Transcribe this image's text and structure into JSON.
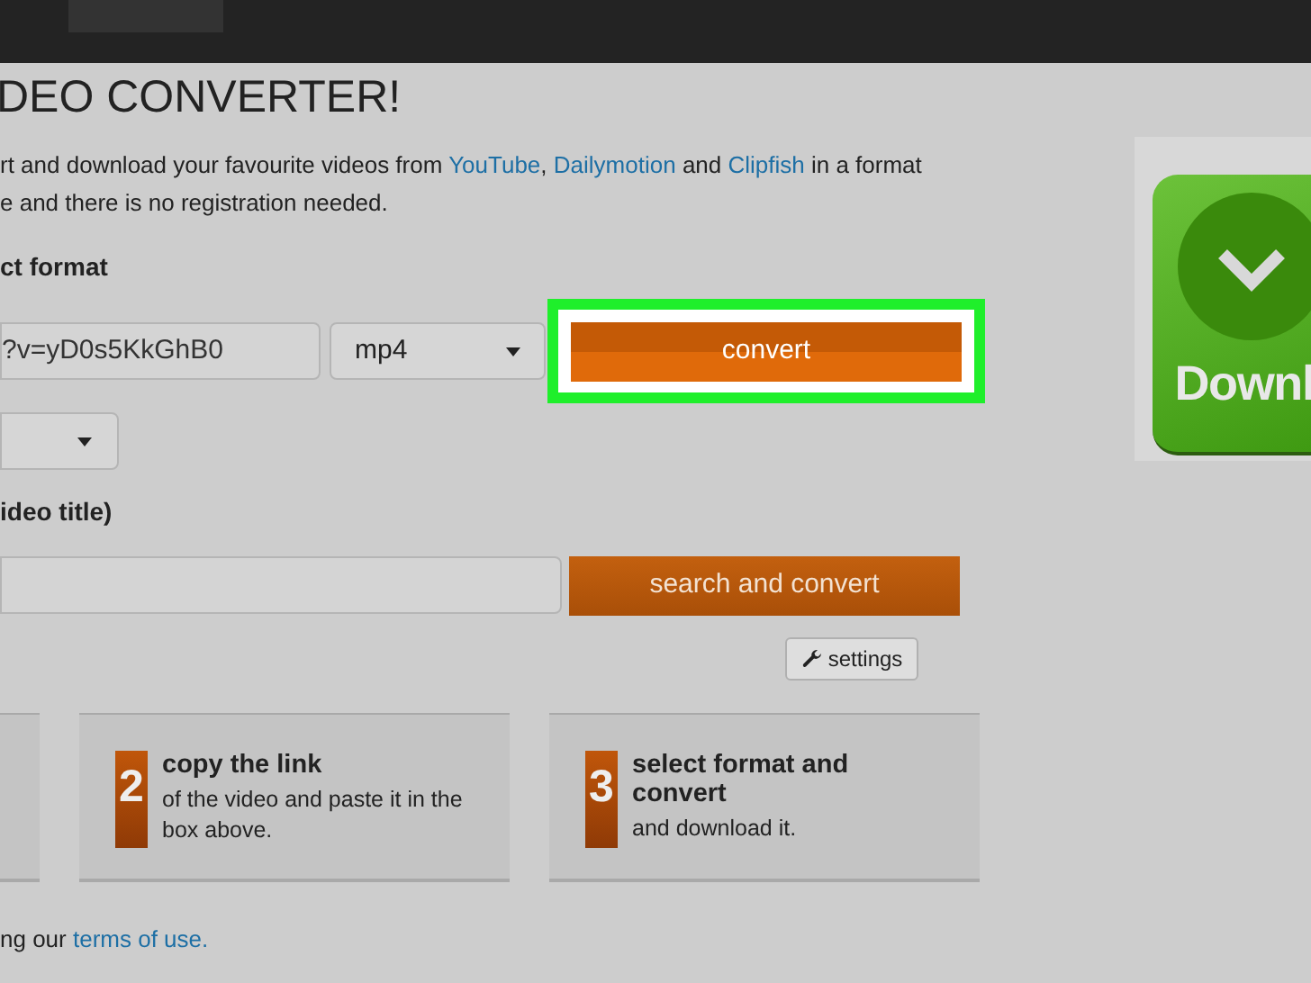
{
  "heading": "DEO CONVERTER!",
  "intro": {
    "parts": [
      {
        "kind": "text",
        "text": "rt and download your favourite videos from "
      },
      {
        "kind": "link",
        "text": "YouTube",
        "after": ", "
      },
      {
        "kind": "link",
        "text": "Dailymotion"
      },
      {
        "kind": "text",
        "text": " and "
      },
      {
        "kind": "link",
        "text": "Clipfish"
      },
      {
        "kind": "text",
        "text": " in a format"
      }
    ],
    "line_2": "e and there is no registration needed."
  },
  "format_label": "ct format",
  "url_field": {
    "value": "?v=yD0s5KkGhB0"
  },
  "format_select": {
    "value": "mp4"
  },
  "convert_button": {
    "label": "convert",
    "highlighted": true
  },
  "search_label": "ideo title)",
  "search_button": "search and convert",
  "settings_button": "settings",
  "steps": [
    {
      "kind": "cut"
    },
    {
      "kind": "full",
      "number": "2",
      "title": "copy the link",
      "text": "of the video and paste it in the box above."
    },
    {
      "kind": "full",
      "number": "3",
      "title": "select format and convert",
      "text": "and download it."
    }
  ],
  "footer": {
    "text": "ng our ",
    "link": "terms of use."
  },
  "download_tile": {
    "label": "Downl"
  }
}
